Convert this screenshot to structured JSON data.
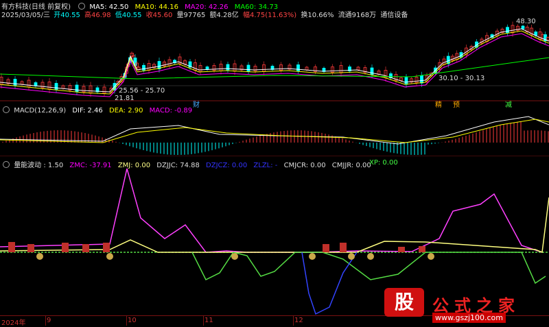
{
  "header": {
    "stock_name": "有方科技(日线 前复权)",
    "ma5": "MA5: 42.50",
    "ma10": "MA10: 44.16",
    "ma20": "MA20: 42.26",
    "ma60": "MA60: 34.73",
    "date": "2025/03/05/三",
    "open": "开40.55",
    "high": "高46.98",
    "low": "低40.55",
    "close": "收45.60",
    "volume": "量97765",
    "amount": "额4.28亿",
    "change": "幅4.75(11.63%)",
    "turnover": "换10.66%",
    "float": "流通9168万",
    "industry": "通信设备"
  },
  "price_annotations": {
    "high_peak": "48.30",
    "range1": "25.56 - 25.70",
    "low1": "21.81",
    "range2": "30.10 - 30.13"
  },
  "events": {
    "cai": "财",
    "jing": "精",
    "yu": "预",
    "jian": "减"
  },
  "macd": {
    "label": "MACD(12,26,9)",
    "dif": "DIF: 2.46",
    "dea": "DEA: 2.90",
    "macd": "MACD: -0.89"
  },
  "volume_indicator": {
    "label": "量能波动 : 1.50",
    "zmc": "ZMC: -37.91",
    "zmj": "ZMJ: 0.00",
    "dzjjc": "DZJJC: 74.88",
    "dzjcz": "DZJCZ: 0.00",
    "zlzl": "ZLZL: -",
    "cmjcr": "CMJCR: 0.00",
    "cmjjr": "CMJJR: 0.00",
    "xp": "XP: 0.00"
  },
  "x_axis": {
    "year": "2024年",
    "m9": "9",
    "m10": "10",
    "m11": "11",
    "m12": "12"
  },
  "watermark": {
    "char": "股",
    "title": "公式之家",
    "url": "www.gszj100.com"
  },
  "colors": {
    "ma5": "#ffffff",
    "ma10": "#ffff00",
    "ma20": "#ff00ff",
    "ma60": "#00ff00",
    "up": "#ff3b3b",
    "down": "#00ffff",
    "zmc": "#ff40ff",
    "zmj": "#ffff80",
    "green": "#55dd44",
    "blue": "#3344ff"
  }
}
